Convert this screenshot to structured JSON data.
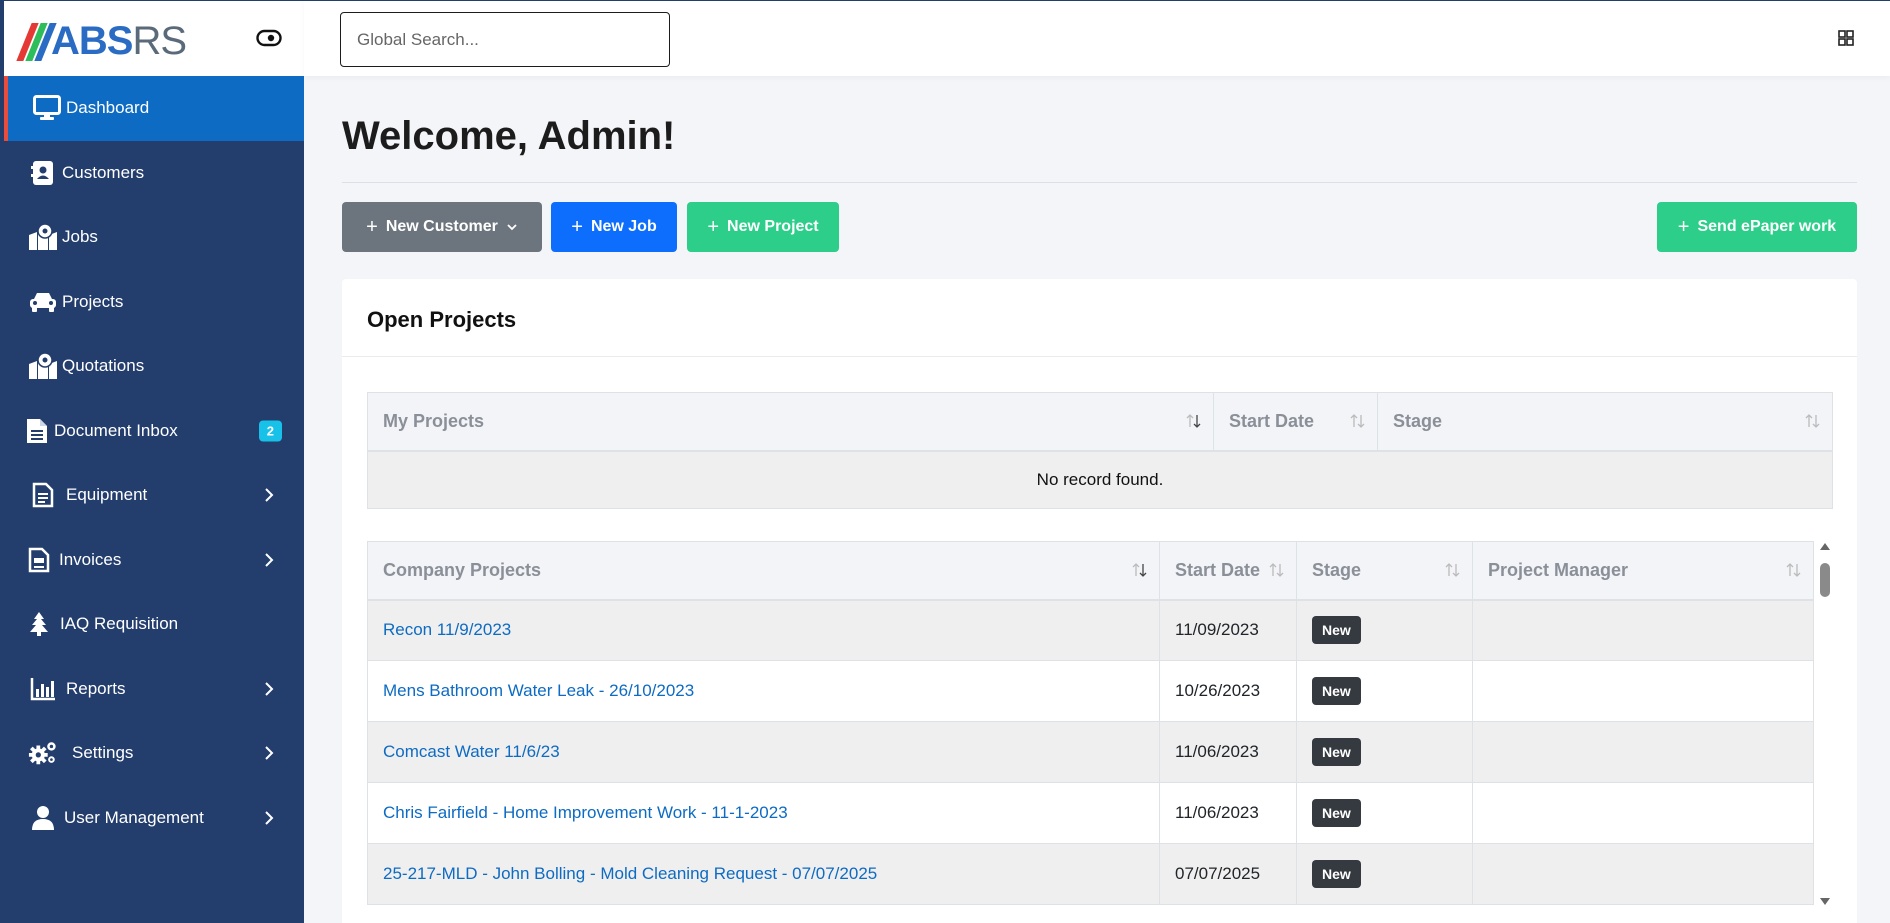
{
  "brand": {
    "logo_text_bold": "ABS",
    "logo_text_light": "RS",
    "stripe_colors": [
      "#e53935",
      "#2dbd5a",
      "#2a6cc3"
    ]
  },
  "sidebar": {
    "items": [
      {
        "label": "Dashboard",
        "icon": "monitor-icon",
        "active": true
      },
      {
        "label": "Customers",
        "icon": "contact-book-icon"
      },
      {
        "label": "Jobs",
        "icon": "map-marker-icon"
      },
      {
        "label": "Projects",
        "icon": "car-icon"
      },
      {
        "label": "Quotations",
        "icon": "map-marker-icon"
      },
      {
        "label": "Document Inbox",
        "icon": "document-icon",
        "badge": "2"
      },
      {
        "label": "Equipment",
        "icon": "document-lines-icon",
        "has_submenu": true
      },
      {
        "label": "Invoices",
        "icon": "invoice-icon",
        "has_submenu": true
      },
      {
        "label": "IAQ Requisition",
        "icon": "tree-icon"
      },
      {
        "label": "Reports",
        "icon": "bar-chart-icon",
        "has_submenu": true
      },
      {
        "label": "Settings",
        "icon": "gears-icon",
        "has_submenu": true
      },
      {
        "label": "User Management",
        "icon": "user-icon",
        "has_submenu": true
      }
    ]
  },
  "topbar": {
    "search_placeholder": "Global Search..."
  },
  "main": {
    "welcome": "Welcome, Admin!",
    "buttons": {
      "new_customer": "New Customer",
      "new_job": "New Job",
      "new_project": "New Project",
      "send_epaper": "Send ePaper work"
    },
    "card_title": "Open Projects",
    "my_projects": {
      "headers": [
        "My Projects",
        "Start Date",
        "Stage"
      ],
      "empty_text": "No record found."
    },
    "company_projects": {
      "headers": [
        "Company Projects",
        "Start Date",
        "Stage",
        "Project Manager"
      ],
      "rows": [
        {
          "name": "Recon 11/9/2023",
          "start_date": "11/09/2023",
          "stage": "New",
          "manager": ""
        },
        {
          "name": "Mens Bathroom Water Leak - 26/10/2023",
          "start_date": "10/26/2023",
          "stage": "New",
          "manager": ""
        },
        {
          "name": "Comcast Water 11/6/23",
          "start_date": "11/06/2023",
          "stage": "New",
          "manager": ""
        },
        {
          "name": "Chris Fairfield - Home Improvement Work - 11-1-2023",
          "start_date": "11/06/2023",
          "stage": "New",
          "manager": ""
        },
        {
          "name": "25-217-MLD - John Bolling - Mold Cleaning Request - 07/07/2025",
          "start_date": "07/07/2025",
          "stage": "New",
          "manager": ""
        }
      ]
    }
  },
  "colors": {
    "sidebar_bg": "#233d6d",
    "active_bg": "#0d6bc3",
    "active_marker": "#e74c3c",
    "primary": "#0d6efd",
    "success": "#2dce89",
    "secondary": "#6c757d",
    "badge_info": "#17c1e8"
  }
}
